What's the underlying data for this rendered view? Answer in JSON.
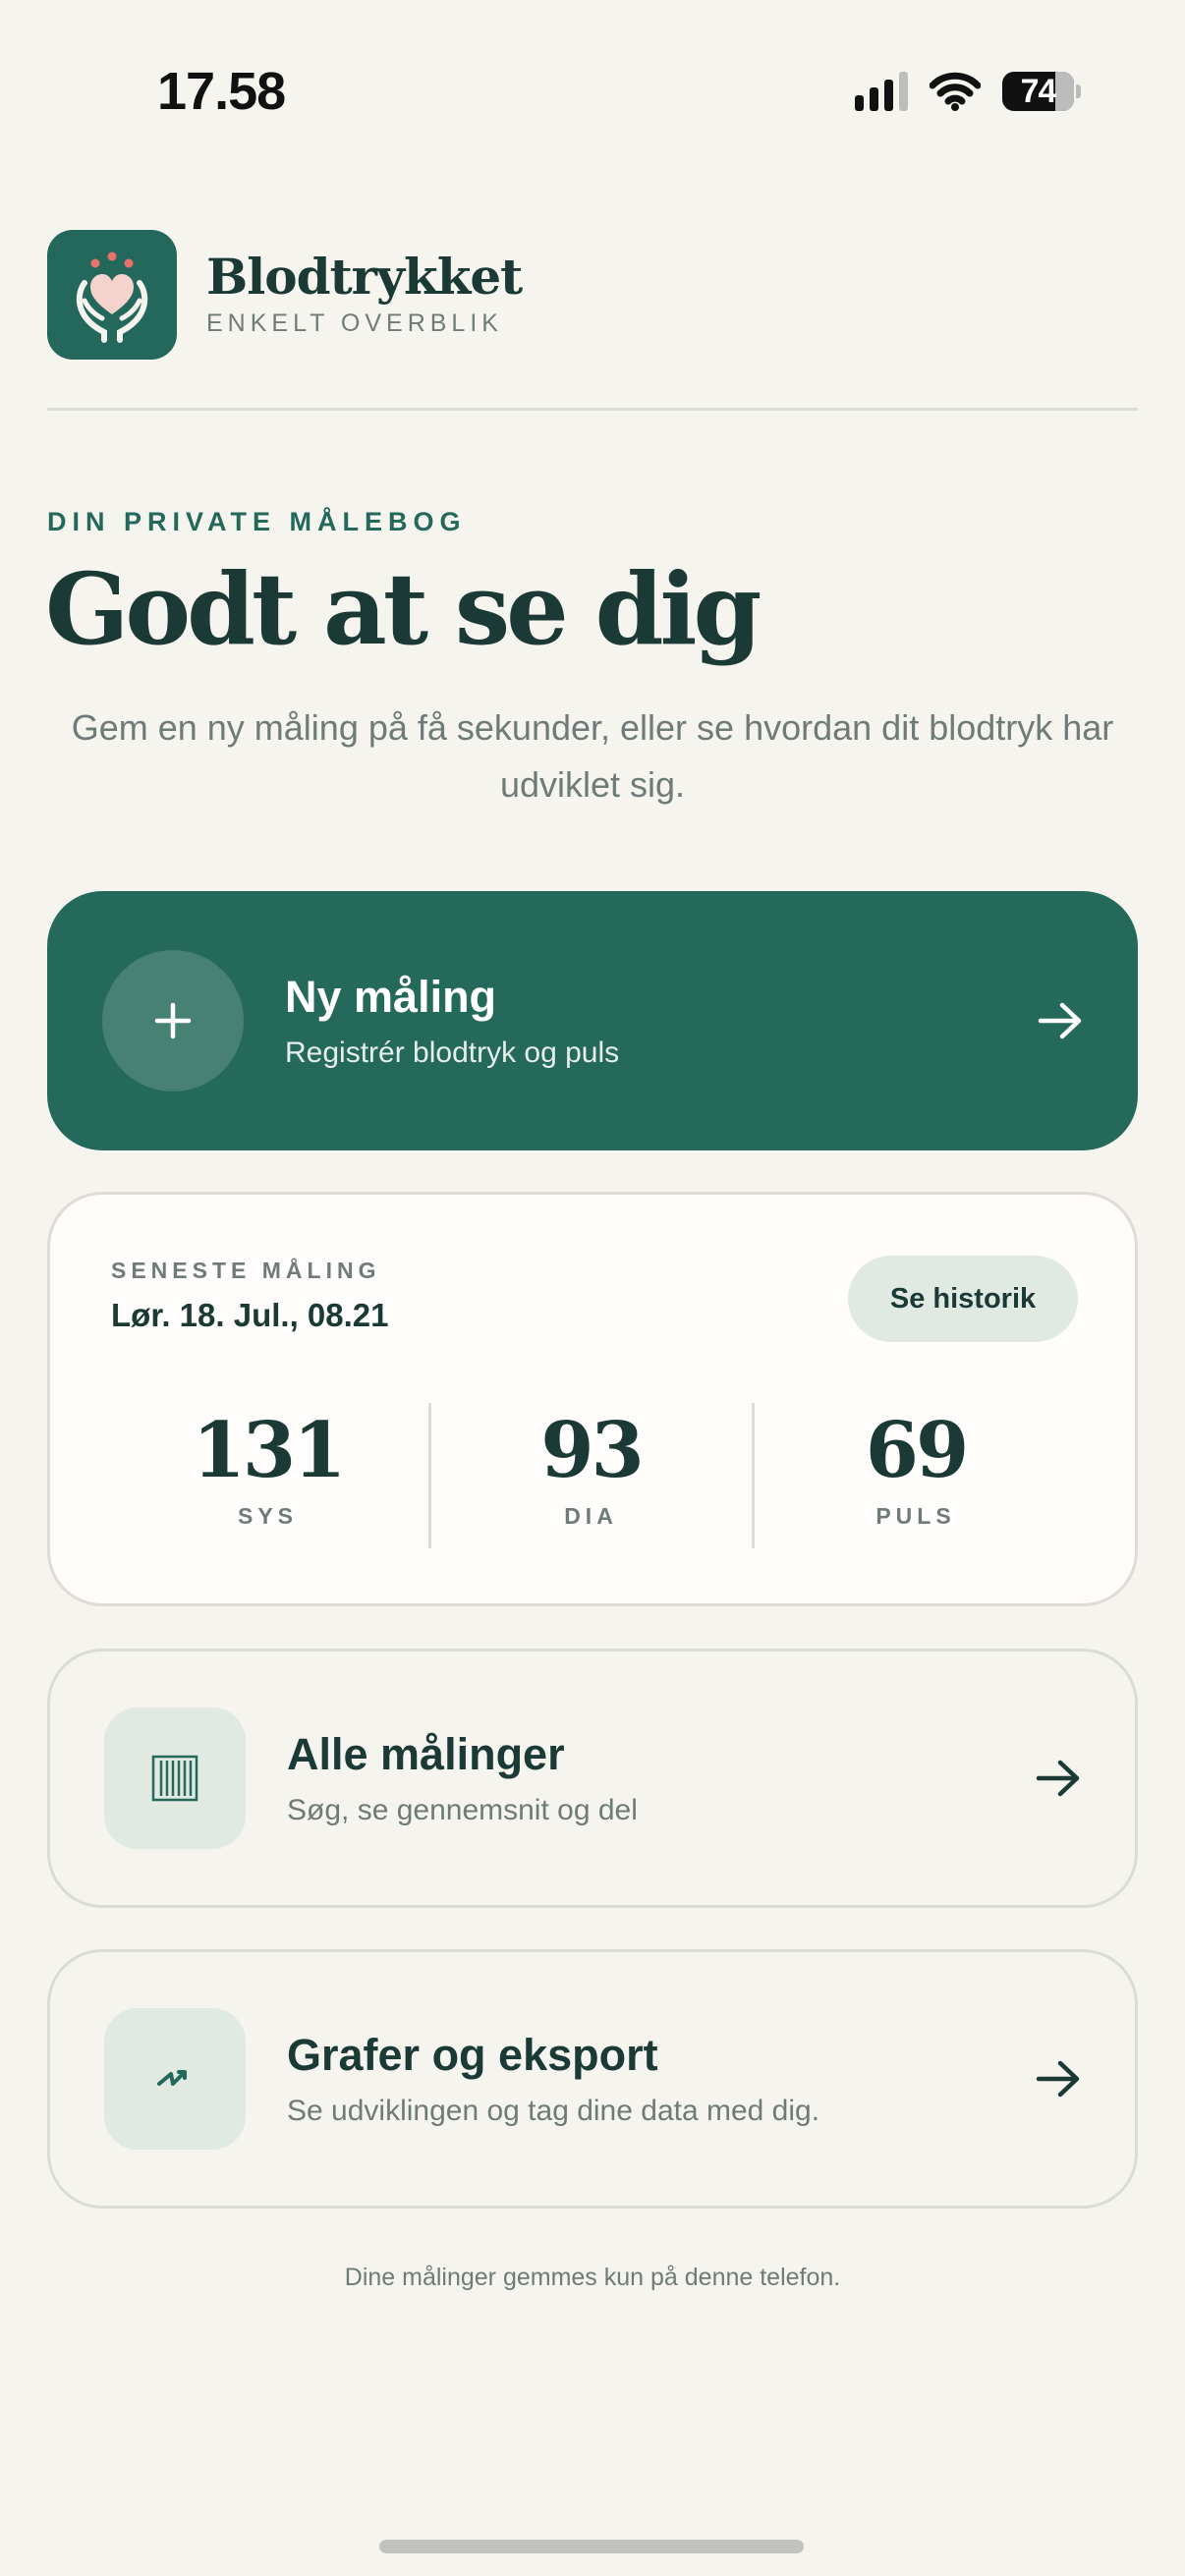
{
  "status_bar": {
    "time": "17.58",
    "battery": "74",
    "battery_level": 0.74
  },
  "header": {
    "app_title": "Blodtrykket",
    "app_subtitle": "ENKELT OVERBLIK"
  },
  "intro": {
    "eyebrow": "DIN PRIVATE MÅLEBOG",
    "greeting": "Godt at se dig",
    "description": "Gem en ny måling på få sekunder, eller se hvordan dit blodtryk har udviklet sig."
  },
  "new_measurement": {
    "title": "Ny måling",
    "subtitle": "Registrér blodtryk og puls"
  },
  "latest": {
    "label": "SENESTE MÅLING",
    "date": "Lør. 18. Jul., 08.21",
    "history_button": "Se historik",
    "readings": [
      {
        "value": "131",
        "unit": "SYS"
      },
      {
        "value": "93",
        "unit": "DIA"
      },
      {
        "value": "69",
        "unit": "PULS"
      }
    ]
  },
  "all_measurements": {
    "title": "Alle målinger",
    "subtitle": "Søg, se gennemsnit og del"
  },
  "graphs_export": {
    "title": "Grafer og eksport",
    "subtitle": "Se udviklingen og tag dine data med dig."
  },
  "footer": {
    "note": "Dine målinger gemmes kun på denne telefon."
  },
  "colors": {
    "accent": "#24695a",
    "background": "#f6f4ef",
    "text_dark": "#1b3a36",
    "text_muted": "#6f7b78",
    "chip": "#e1e9e3",
    "heart": "#f4d3cd",
    "dots": "#e8736b"
  }
}
